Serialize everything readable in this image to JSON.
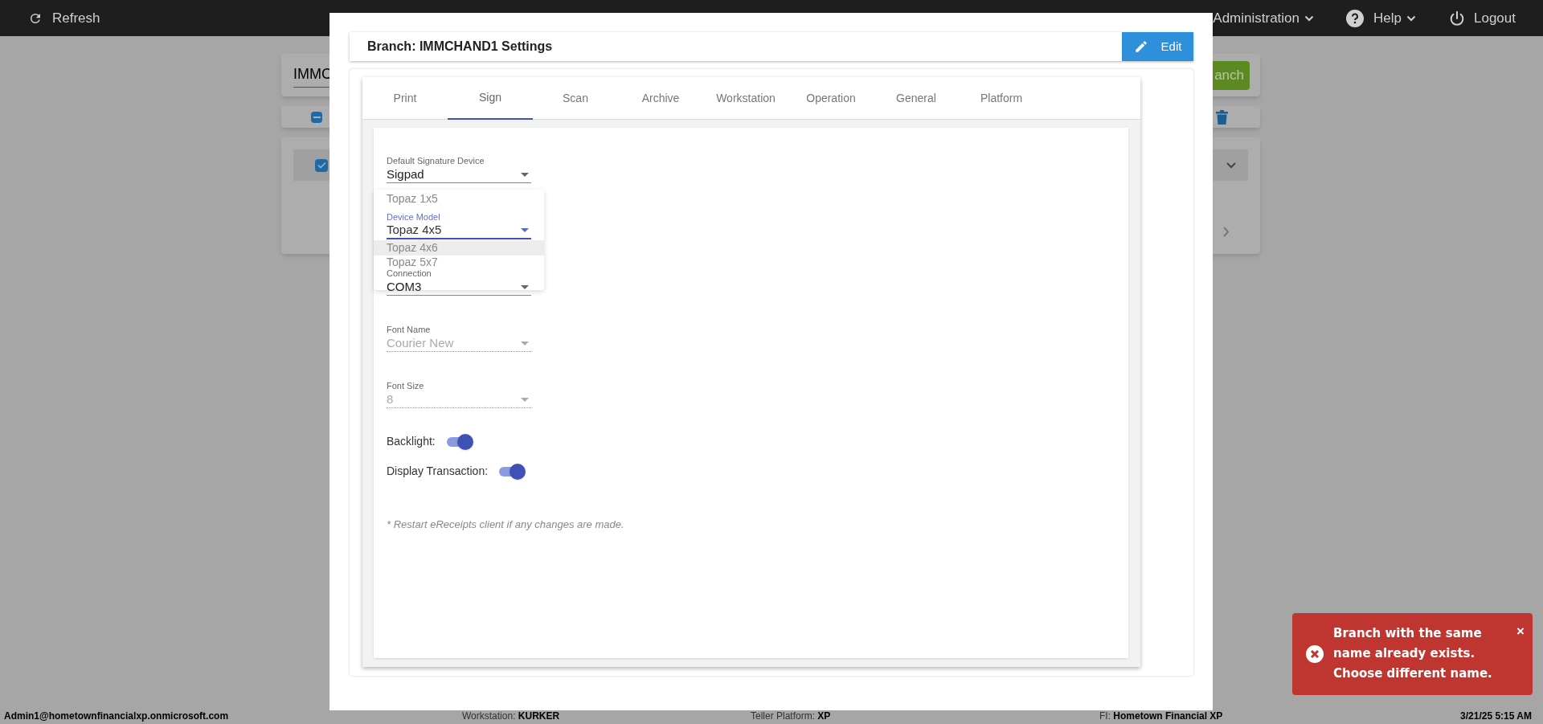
{
  "top_bar": {
    "refresh": "Refresh",
    "menus": [
      {
        "label": "Administration"
      },
      {
        "label": "Help"
      }
    ],
    "logout": "Logout"
  },
  "background_page": {
    "search_value": "IMMC",
    "add_button": "anch",
    "bulk_checkbox": {
      "indeterminate": true
    },
    "row_checkbox": {
      "checked": true
    }
  },
  "modal": {
    "title": "Branch: IMMCHAND1 Settings",
    "edit_button": "Edit",
    "tabs": [
      {
        "label": "Print",
        "selected": false
      },
      {
        "label": "Sign",
        "selected": true
      },
      {
        "label": "Scan",
        "selected": false
      },
      {
        "label": "Archive",
        "selected": false
      },
      {
        "label": "Workstation",
        "selected": false
      },
      {
        "label": "Operation",
        "selected": false
      },
      {
        "label": "General",
        "selected": false
      },
      {
        "label": "Platform",
        "selected": false
      }
    ],
    "fields": [
      {
        "label": "Default Signature Device",
        "value": "Sigpad",
        "disabled": false,
        "focused": false
      },
      {
        "label": "Device Model",
        "value": "Topaz 4x5",
        "disabled": false,
        "focused": true
      },
      {
        "label": "Connection",
        "value": "COM3",
        "disabled": false,
        "focused": false
      },
      {
        "label": "Font Name",
        "value": "Courier New",
        "disabled": true,
        "focused": false
      },
      {
        "label": "Font Size",
        "value": "8",
        "disabled": true,
        "focused": false
      }
    ],
    "open_menu": {
      "options": [
        {
          "label": "Topaz 1x5",
          "highlighted": false
        },
        {
          "label": "Topaz 4x6",
          "highlighted": true
        },
        {
          "label": "Topaz 5x7",
          "highlighted": false
        }
      ]
    },
    "toggles": [
      {
        "label": "Backlight:",
        "on": true
      },
      {
        "label": "Display Transaction:",
        "on": true
      }
    ],
    "note": "* Restart eReceipts client if any changes are made."
  },
  "toast": {
    "message": "Branch with the same name already exists. Choose different name.",
    "close": "×"
  },
  "status_bar": [
    {
      "value": "Admin1@hometownfinancialxp.onmicrosoft.com"
    },
    {
      "label": "Workstation:",
      "value": "KURKER"
    },
    {
      "label": "Teller Platform:",
      "value": "XP"
    },
    {
      "label": "FI:",
      "value": "Hometown Financial XP"
    },
    {
      "value": "3/21/25 5:15 AM"
    }
  ]
}
